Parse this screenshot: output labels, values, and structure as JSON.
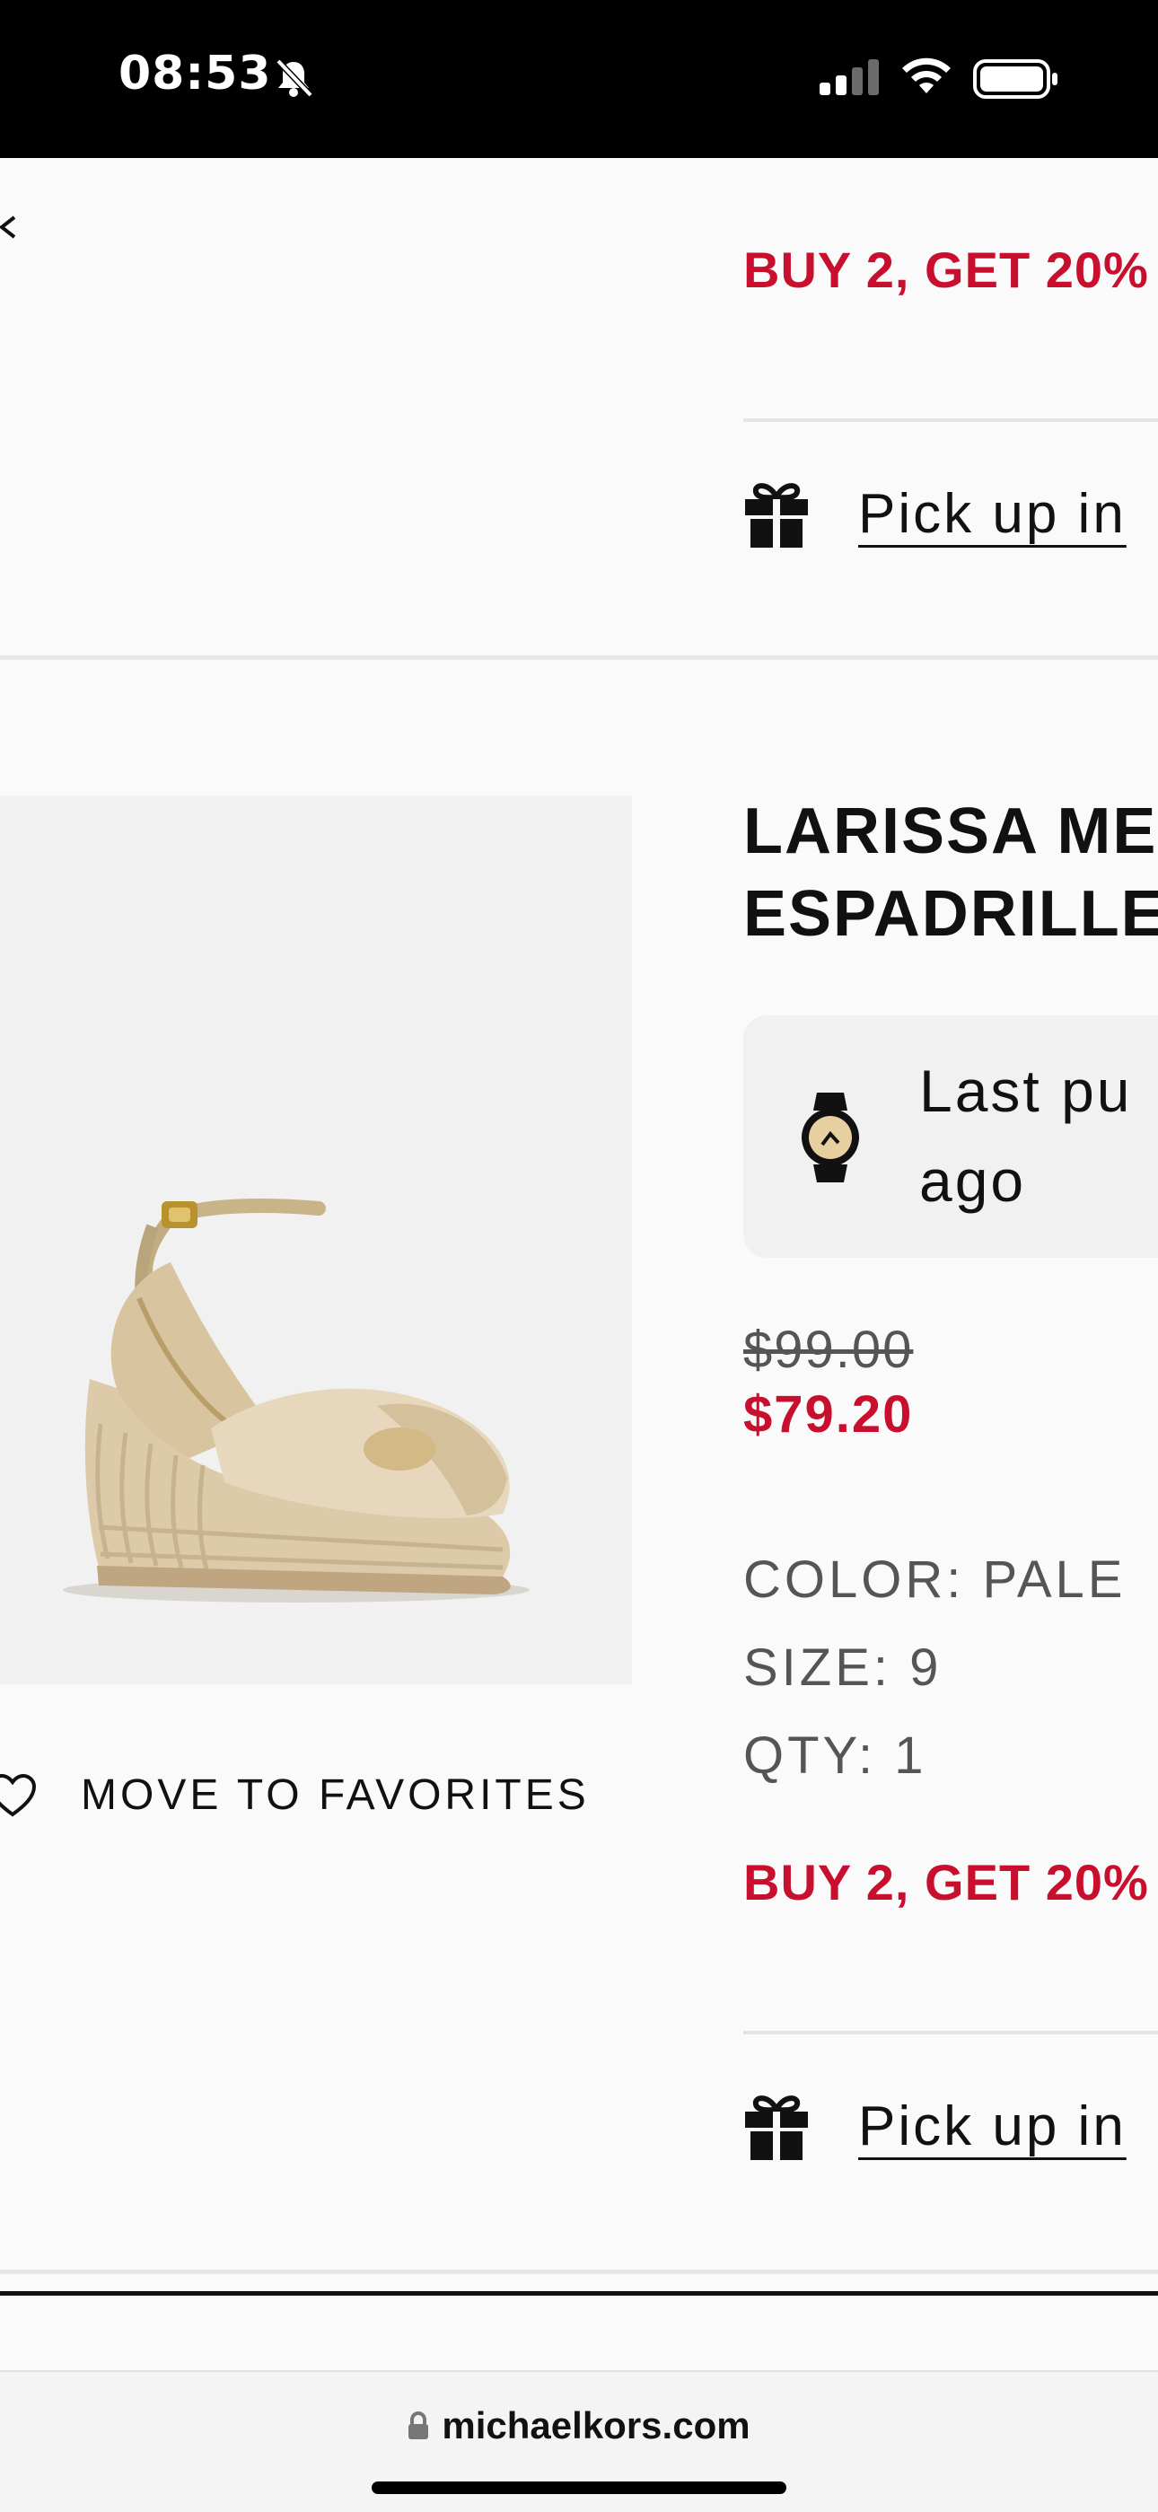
{
  "status_bar": {
    "time": "08:53"
  },
  "cart": {
    "prev_item": {
      "promo": "BUY 2, GET 20%",
      "pickup_label": "Pick up in"
    },
    "item": {
      "title_line1": "LARISSA ME",
      "title_line2": "ESPADRILLE",
      "notice_line1": "Last pu",
      "notice_line2": "ago",
      "price_original": "$99.00",
      "price_sale": "$79.20",
      "color": "COLOR: PALE",
      "size": "SIZE: 9",
      "qty": "QTY: 1",
      "promo": "BUY 2, GET 20%",
      "pickup_label": "Pick up in",
      "move_to_favorites": "MOVE TO FAVORITES"
    }
  },
  "browser": {
    "url": "michaelkors.com"
  },
  "colors": {
    "promo_red": "#c8102e",
    "text_dark": "#111111",
    "muted": "#555555"
  }
}
